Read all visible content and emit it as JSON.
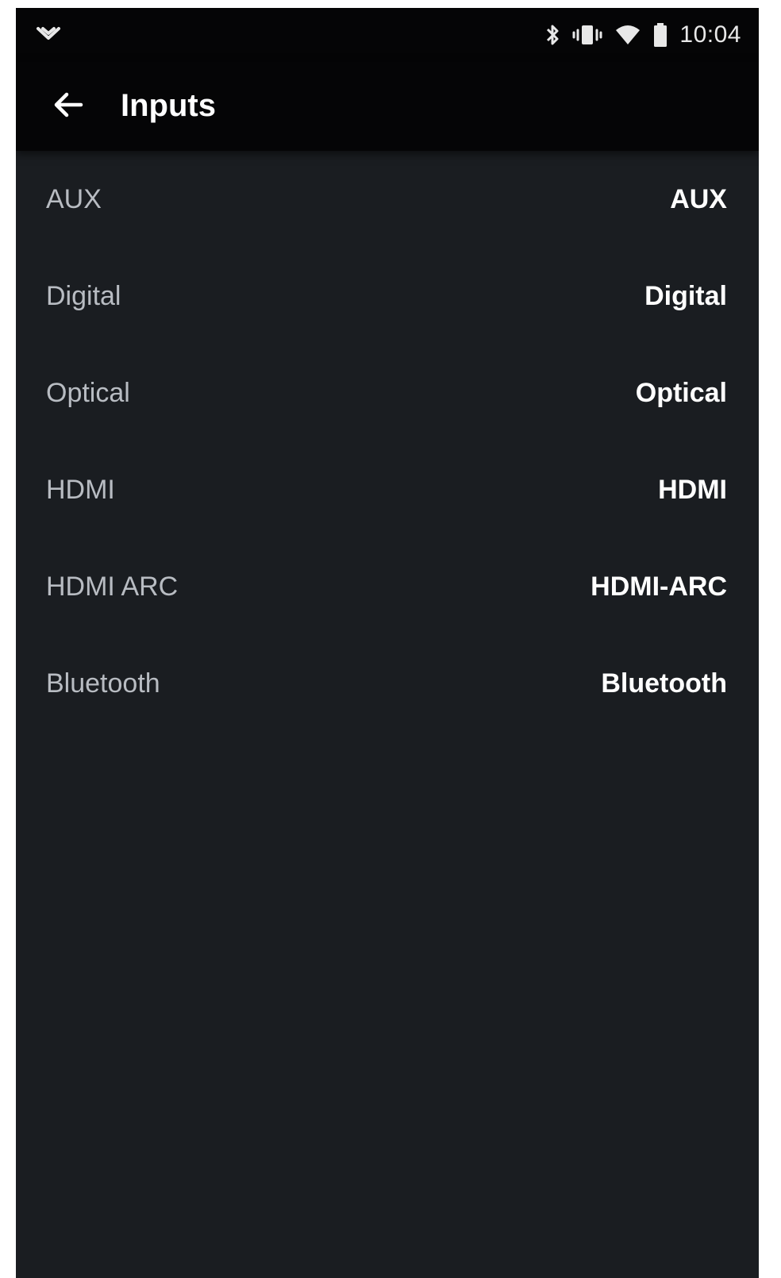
{
  "status_bar": {
    "time": "10:04",
    "icons": [
      "notification-chevron-icon",
      "bluetooth-icon",
      "vibrate-icon",
      "wifi-icon",
      "battery-icon"
    ]
  },
  "app_bar": {
    "title": "Inputs",
    "back_icon": "arrow-left-icon"
  },
  "inputs": [
    {
      "label": "AUX",
      "value": "AUX"
    },
    {
      "label": "Digital",
      "value": "Digital"
    },
    {
      "label": "Optical",
      "value": "Optical"
    },
    {
      "label": "HDMI",
      "value": "HDMI"
    },
    {
      "label": "HDMI ARC",
      "value": "HDMI-ARC"
    },
    {
      "label": "Bluetooth",
      "value": "Bluetooth"
    }
  ],
  "colors": {
    "background": "#1a1d21",
    "bar": "#050506",
    "label": "#b8bcc2",
    "value": "#ffffff"
  }
}
